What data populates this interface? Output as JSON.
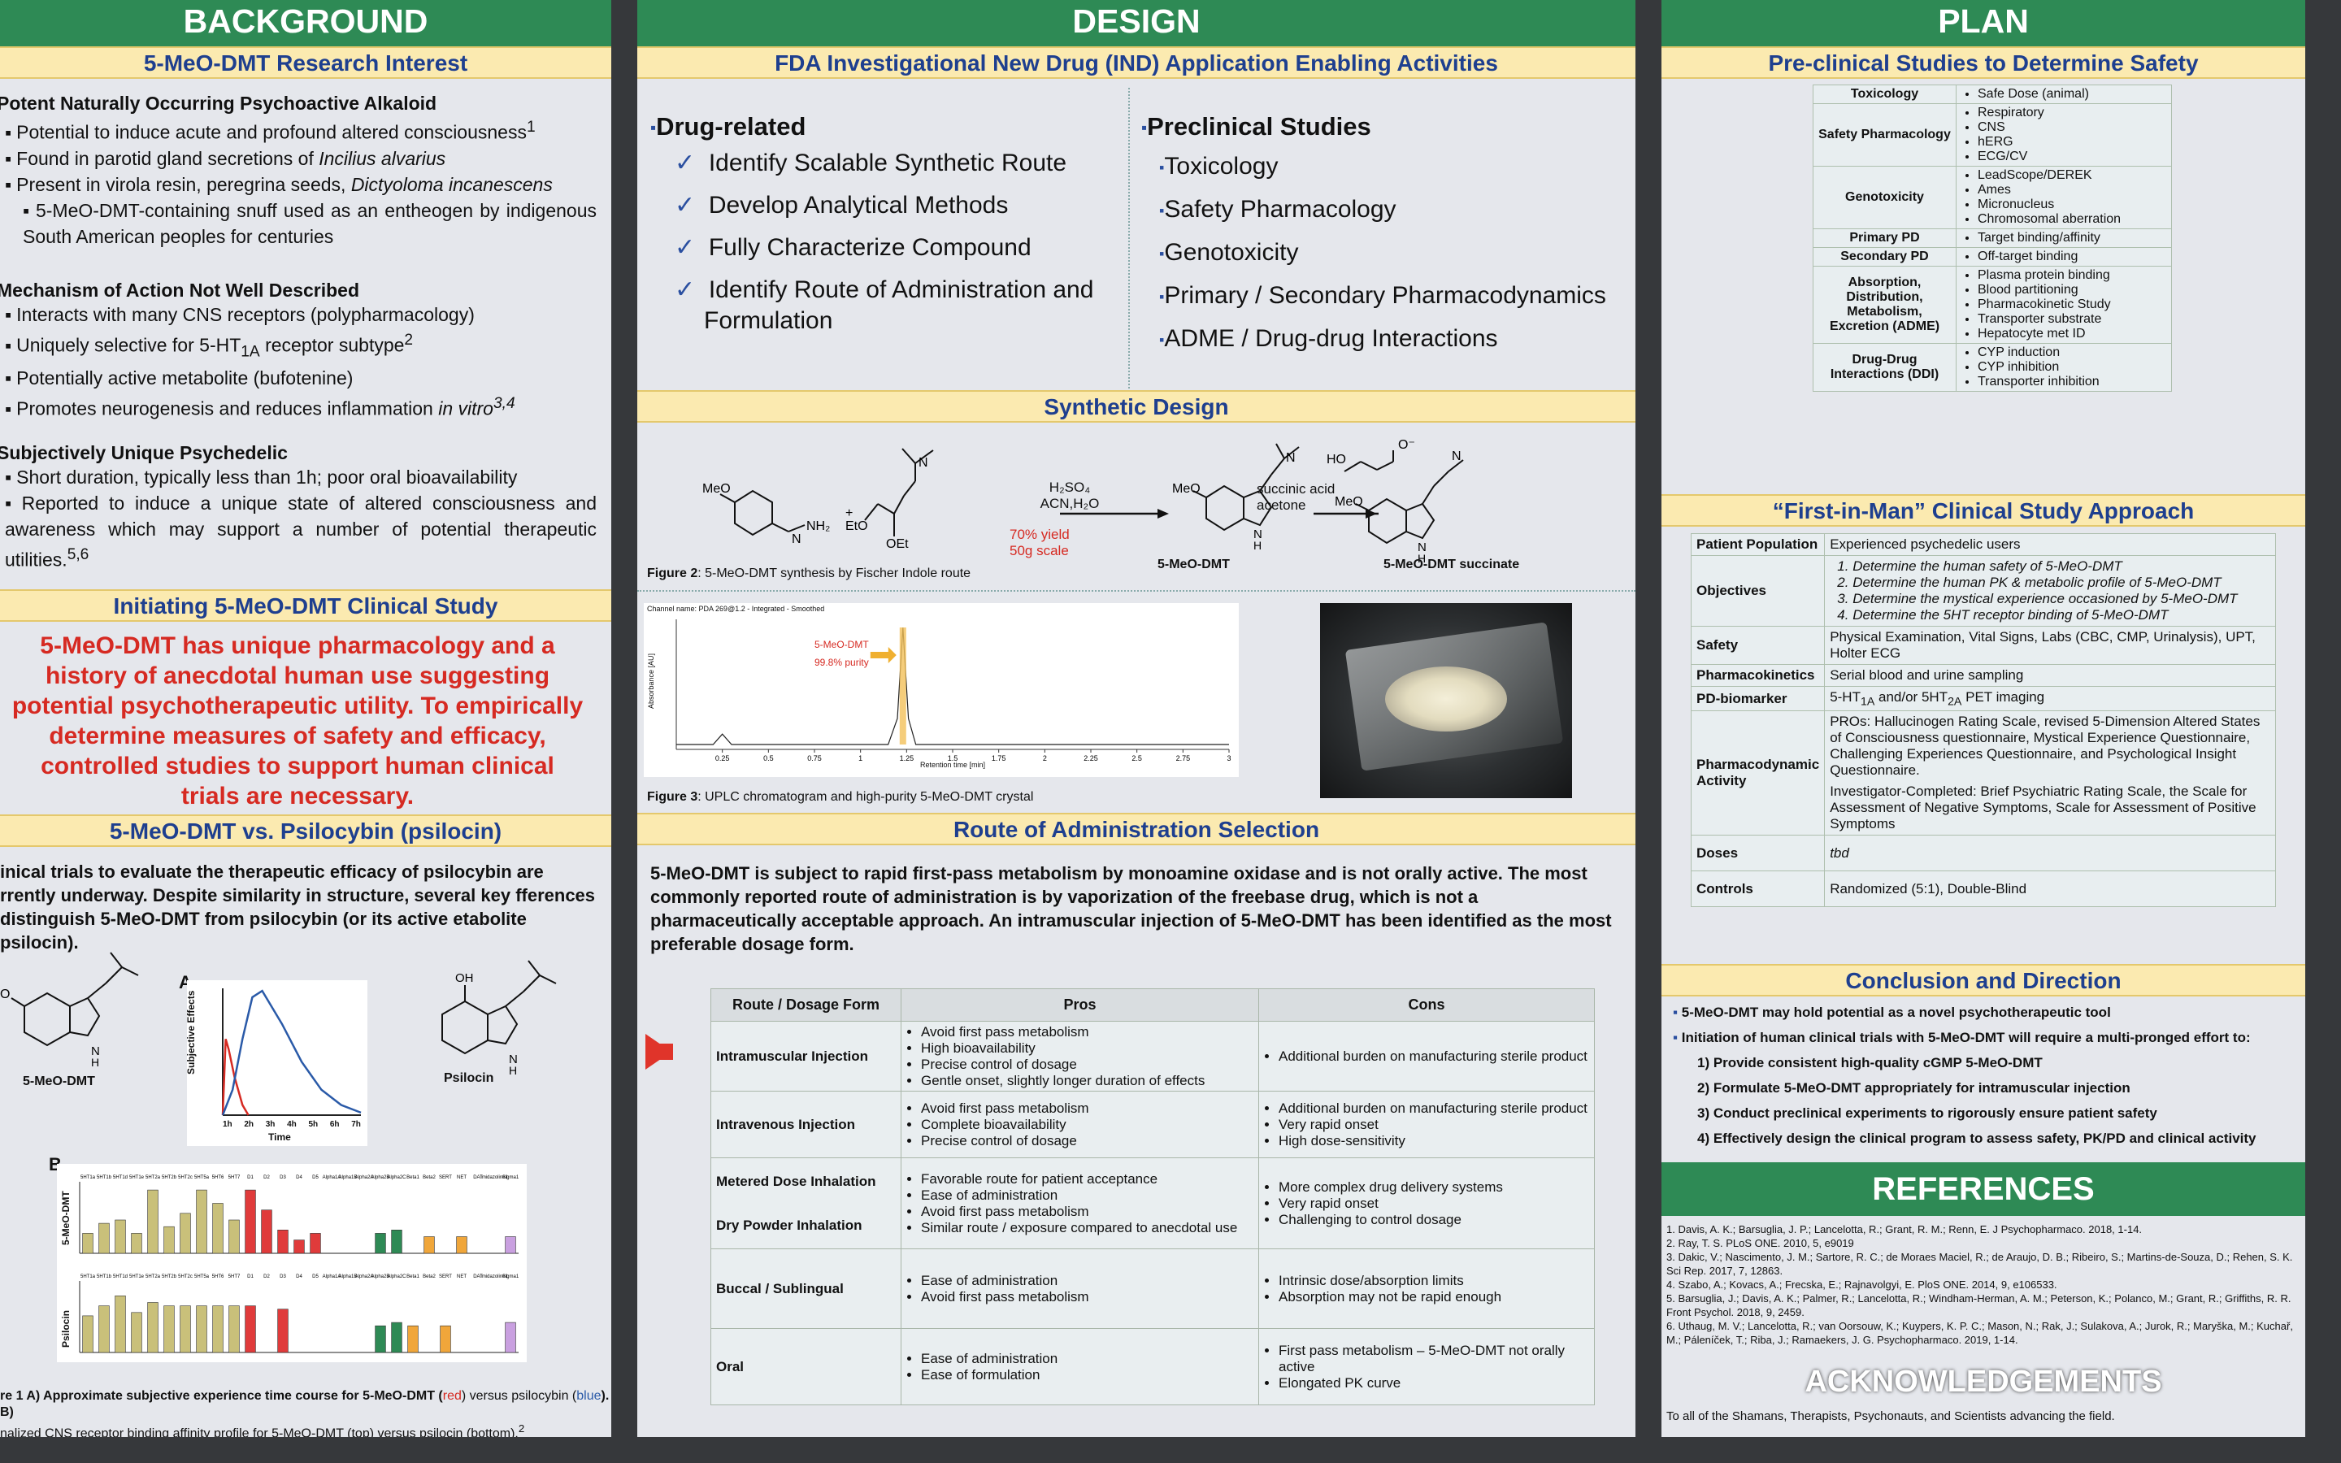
{
  "background": {
    "header": "BACKGROUND",
    "research_title": "5-MeO-DMT Research Interest",
    "g1": {
      "title": "Potent Naturally Occurring Psychoactive Alkaloid",
      "b1": "Potential to induce acute and profound altered consciousness",
      "b1sup": "1",
      "b2": "Found in parotid gland secretions of",
      "b2i": "Incilius alvarius",
      "b3": "Present in virola resin, peregrina seeds,",
      "b3i": "Dictyoloma incanescens",
      "b4": "5-MeO-DMT-containing snuff used as an entheogen by indigenous South American peoples for centuries"
    },
    "g2": {
      "title": "Mechanism of Action Not Well Described",
      "b1": "Interacts with many CNS receptors (polypharmacology)",
      "b2": "Uniquely selective for 5-HT",
      "b2sub": "1A",
      "b2b": " receptor subtype",
      "b2sup": "2",
      "b3": "Potentially active metabolite (bufotenine)",
      "b4": "Promotes neurogenesis and reduces inflammation",
      "b4i": "in vitro",
      "b4sup": "3,4"
    },
    "g3": {
      "title": "Subjectively Unique Psychedelic",
      "b1": "Short duration, typically less than 1h; poor oral bioavailability",
      "b2": "Reported to induce a unique state of altered consciousness and awareness which may support a number of potential therapeutic utilities.",
      "b2sup": "5,6"
    },
    "initiating_title": "Initiating 5-MeO-DMT Clinical Study",
    "initiating_text": "5-MeO-DMT has unique pharmacology and a history of anecdotal human use suggesting potential psychotherapeutic utility. To empirically determine measures of safety and efficacy, controlled studies to support human clinical trials are necessary.",
    "vs_title": "5-MeO-DMT vs. Psilocybin (psilocin)",
    "vs_text": "inical trials to evaluate the therapeutic efficacy of psilocybin are rrently underway.  Despite similarity in structure, several key fferences distinguish 5-MeO-DMT from psilocybin (or its active etabolite psilocin).",
    "mol1": "5-MeO-DMT",
    "mol2": "Psilocin",
    "panel_a": "A",
    "panel_b": "B",
    "a_ylabel": "Subjective Effects",
    "a_xlabel": "Time",
    "a_ticks": [
      "1h",
      "2h",
      "3h",
      "4h",
      "5h",
      "6h",
      "7h"
    ],
    "b_ylabel1": "5-MeO-DMT",
    "b_ylabel2": "Psilocin",
    "fig1_caption_pre": "re 1  A) Approximate subjective experience time course for 5-MeO-DMT (",
    "fig1_red": "red",
    "fig1_mid": ") versus psilocybin (",
    "fig1_blue": "blue",
    "fig1_post": "). B)",
    "fig1_caption2": "nalized CNS receptor binding affinity profile for 5-MeO-DMT (top) versus psilocin (bottom).",
    "fig1_sup": "2"
  },
  "design": {
    "header": "DESIGN",
    "fda_title": "FDA Investigational New Drug (IND) Application Enabling Activities",
    "drug_title": "Drug-related",
    "drug_items": [
      "Identify Scalable Synthetic Route",
      "Develop Analytical Methods",
      "Fully Characterize Compound",
      "Identify Route of Administration and Formulation"
    ],
    "pre_title": "Preclinical Studies",
    "pre_items": [
      "Toxicology",
      "Safety Pharmacology",
      "Genotoxicity",
      "Primary / Secondary Pharmacodynamics",
      "ADME / Drug-drug Interactions"
    ],
    "synthetic_title": "Synthetic Design",
    "rxn_cond1": "H₂SO₄",
    "rxn_cond2": "ACN,H₂O",
    "rxn_yield": "70% yield",
    "rxn_scale": "50g scale",
    "rxn_reagent1": "succinic acid",
    "rxn_reagent2": "acetone",
    "prod1": "5-MeO-DMT",
    "prod2": "5-MeO-DMT succinate",
    "fig2_label": "Figure 2",
    "fig2_text": ": 5-MeO-DMT synthesis by Fischer Indole route",
    "chrom_title": "Channel name: PDA 269@1.2 - Integrated - Smoothed",
    "chrom_peak": "5-MeO-DMT",
    "chrom_purity": "99.8% purity",
    "chrom_xlabel": "Retention time [min]",
    "chrom_ylabel": "Absorbance [AU]",
    "fig3_label": "Figure 3",
    "fig3_text": ": UPLC chromatogram and high-purity 5-MeO-DMT crystal",
    "roa_title": "Route of Administration Selection",
    "roa_text": "5-MeO-DMT is subject to rapid first-pass metabolism by monoamine oxidase and is not orally active. The most commonly reported route of administration is by vaporization of the freebase drug, which is not a pharmaceutically acceptable approach.  An intramuscular injection of 5-MeO-DMT has been identified as the most preferable dosage form.",
    "roa_headers": [
      "Route / Dosage Form",
      "Pros",
      "Cons"
    ],
    "roa_rows": [
      {
        "route": "Intramuscular Injection",
        "pros": [
          "Avoid first pass metabolism",
          "High bioavailability",
          "Precise control of dosage",
          "Gentle onset, slightly longer duration of effects"
        ],
        "cons": [
          "Additional burden on manufacturing sterile product"
        ]
      },
      {
        "route": "Intravenous Injection",
        "pros": [
          "Avoid first pass metabolism",
          "Complete bioavailability",
          "Precise control of dosage"
        ],
        "cons": [
          "Additional burden on manufacturing sterile product",
          "Very rapid onset",
          "High dose-sensitivity"
        ]
      },
      {
        "route": "Metered Dose Inhalation",
        "route2": "Dry Powder Inhalation",
        "pros": [
          "Favorable route for patient acceptance",
          "Ease of administration",
          "Avoid first pass metabolism",
          "Similar route / exposure compared to anecdotal use"
        ],
        "cons": [
          "More complex drug delivery systems",
          "Very rapid onset",
          "Challenging to control dosage"
        ]
      },
      {
        "route": "Buccal / Sublingual",
        "pros": [
          "Ease of administration",
          "Avoid first pass metabolism"
        ],
        "cons": [
          "Intrinsic dose/absorption limits",
          "Absorption may not be rapid enough"
        ]
      },
      {
        "route": "Oral",
        "pros": [
          "Ease of administration",
          "Ease of formulation"
        ],
        "cons": [
          "First pass metabolism – 5-MeO-DMT not orally active",
          "Elongated PK curve"
        ]
      }
    ]
  },
  "plan": {
    "header": "PLAN",
    "preclinical_title": "Pre-clinical Studies to Determine Safety",
    "safety_rows": [
      {
        "k": "Toxicology",
        "v": [
          "Safe Dose (animal)"
        ]
      },
      {
        "k": "Safety Pharmacology",
        "v": [
          "Respiratory",
          "CNS",
          "hERG",
          "ECG/CV"
        ]
      },
      {
        "k": "Genotoxicity",
        "v": [
          "LeadScope/DEREK",
          "Ames",
          "Micronucleus",
          "Chromosomal aberration"
        ]
      },
      {
        "k": "Primary PD",
        "v": [
          "Target binding/affinity"
        ]
      },
      {
        "k": "Secondary PD",
        "v": [
          "Off-target binding"
        ]
      },
      {
        "k": "Absorption, Distribution, Metabolism, Excretion (ADME)",
        "v": [
          "Plasma protein binding",
          "Blood partitioning",
          "Pharmacokinetic Study",
          "Transporter substrate",
          "Hepatocyte met ID"
        ]
      },
      {
        "k": "Drug-Drug Interactions (DDI)",
        "v": [
          "CYP induction",
          "CYP inhibition",
          "Transporter inhibition"
        ]
      }
    ],
    "fim_title": "“First-in-Man” Clinical Study Approach",
    "fim": {
      "pop_k": "Patient Population",
      "pop_v": "Experienced psychedelic users",
      "obj_k": "Objectives",
      "obj_v": [
        "Determine the human safety of 5-MeO-DMT",
        "Determine the human PK & metabolic profile of 5-MeO-DMT",
        "Determine the mystical experience occasioned by 5-MeO-DMT",
        "Determine the 5HT receptor binding of 5-MeO-DMT"
      ],
      "safety_k": "Safety",
      "safety_v": "Physical Examination, Vital Signs, Labs (CBC, CMP, Urinalysis), UPT, Holter ECG",
      "pk_k": "Pharmacokinetics",
      "pk_v": "Serial blood and urine sampling",
      "pd_k": "PD-biomarker",
      "pd_v1": "5-HT",
      "pd_sub1": "1A",
      "pd_v2": " and/or 5HT",
      "pd_sub2": "2A",
      "pd_v3": " PET imaging",
      "pda_k": "Pharmacodynamic Activity",
      "pda_v1": "PROs: Hallucinogen Rating Scale, revised 5-Dimension Altered States of Consciousness questionnaire, Mystical Experience Questionnaire, Challenging Experiences Questionnaire, and Psychological Insight Questionnaire.",
      "pda_v2": "Investigator-Completed: Brief Psychiatric Rating Scale, the Scale for Assessment of Negative Symptoms, Scale for Assessment of Positive Symptoms",
      "doses_k": "Doses",
      "doses_v": "tbd",
      "ctrl_k": "Controls",
      "ctrl_v": "Randomized (5:1), Double-Blind"
    },
    "conc_title": "Conclusion and Direction",
    "conc_b1": "5-MeO-DMT may hold potential as a novel psychotherapeutic tool",
    "conc_b2": "Initiation of human clinical trials with 5-MeO-DMT will require a multi-pronged effort to:",
    "conc_steps": [
      "1) Provide consistent high-quality cGMP 5-MeO-DMT",
      "2) Formulate 5-MeO-DMT appropriately for intramuscular injection",
      "3) Conduct preclinical experiments to rigorously ensure patient safety",
      "4) Effectively design the clinical program to assess safety, PK/PD and clinical activity"
    ],
    "refs_title": "REFERENCES",
    "refs": [
      "1.    Davis, A. K.; Barsuglia, J. P.; Lancelotta, R.; Grant, R. M.; Renn, E. J Psychopharmaco. 2018, 1-14.",
      "2.    Ray, T. S. PLoS ONE. 2010, 5, e9019",
      "3.    Dakic, V.; Nascimento, J. M.; Sartore, R. C.; de Moraes Maciel, R.; de Araujo, D. B.; Ribeiro, S.; Martins-de-Souza, D.; Rehen, S. K. Sci Rep. 2017, 7, 12863.",
      "4.    Szabo, A.; Kovacs, A.; Frecska, E.; Rajnavolgyi, E. PloS ONE. 2014, 9, e106533.",
      "5.    Barsuglia, J.; Davis, A. K.; Palmer, R.; Lancelotta, R.; Windham-Herman, A. M.; Peterson, K.; Polanco, M.; Grant, R.; Griffiths, R. R. Front Psychol. 2018, 9, 2459.",
      "6.    Uthaug, M. V.; Lancelotta, R.; van Oorsouw, K.; Kuypers, K. P. C.; Mason, N.; Rak, J.; Sulakova, A.; Jurok, R.; Maryška, M.; Kuchař, M.; Páleníček, T.; Riba, J.; Ramaekers, J. G. Psychopharmaco. 2019, 1-14."
    ],
    "ack_title": "ACKNOWLEDGEMENTS",
    "ack_text": "To all of the Shamans, Therapists, Psychonauts, and Scientists advancing the field."
  },
  "chart_data": [
    {
      "type": "line",
      "title": "",
      "xlabel": "Time",
      "ylabel": "Subjective Effects",
      "x_ticks": [
        "1h",
        "2h",
        "3h",
        "4h",
        "5h",
        "6h",
        "7h"
      ],
      "series": [
        {
          "name": "5-MeO-DMT",
          "color": "#d62a22",
          "x": [
            0,
            0.15,
            0.3,
            0.6,
            1.0,
            1.3
          ],
          "y": [
            0,
            0.6,
            0.52,
            0.3,
            0.08,
            0
          ]
        },
        {
          "name": "Psilocybin",
          "color": "#2a5aa8",
          "x": [
            0,
            0.5,
            1.0,
            1.5,
            2.0,
            3.0,
            4.0,
            5.0,
            6.0,
            7.0
          ],
          "y": [
            0,
            0.2,
            0.6,
            0.93,
            0.98,
            0.72,
            0.42,
            0.2,
            0.08,
            0.02
          ]
        }
      ]
    },
    {
      "type": "bar",
      "title": "",
      "ylabel": "5-MeO-DMT",
      "categories": [
        "5HT1a",
        "5HT1b",
        "5HT1d",
        "5HT1e",
        "5HT2a",
        "5HT2b",
        "5HT2c",
        "5HT5a",
        "5HT6",
        "5HT7",
        "D1",
        "D2",
        "D3",
        "D4",
        "D5",
        "Alpha1A",
        "Alpha1B",
        "Alpha2A",
        "Alpha2B",
        "Alpha2C",
        "Beta1",
        "Beta2",
        "SERT",
        "NET",
        "DAT",
        "Imidazoline1",
        "Sigma1"
      ],
      "values": [
        0.3,
        0.45,
        0.5,
        0.3,
        0.95,
        0.4,
        0.6,
        0.95,
        0.75,
        0.5,
        0.95,
        0.65,
        0.35,
        0.2,
        0.3,
        0,
        0,
        0,
        0.3,
        0.35,
        0,
        0.25,
        0,
        0.25,
        0,
        0,
        0.25
      ],
      "colors": [
        "#c9c07a",
        "#c9c07a",
        "#c9c07a",
        "#c9c07a",
        "#c9c07a",
        "#c9c07a",
        "#c9c07a",
        "#c9c07a",
        "#c9c07a",
        "#c9c07a",
        "#e03b3b",
        "#e03b3b",
        "#e03b3b",
        "#e03b3b",
        "#e03b3b",
        "#2e8a55",
        "#2e8a55",
        "#2e8a55",
        "#2e8a55",
        "#2e8a55",
        "#f0a63a",
        "#f0a63a",
        "#f0a63a",
        "#f0a63a",
        "#c9a0e0",
        "#c9a0e0",
        "#c9a0e0"
      ]
    },
    {
      "type": "bar",
      "title": "",
      "ylabel": "Psilocin",
      "categories": [
        "5HT1a",
        "5HT1b",
        "5HT1d",
        "5HT1e",
        "5HT2a",
        "5HT2b",
        "5HT2c",
        "5HT5a",
        "5HT6",
        "5HT7",
        "D1",
        "D2",
        "D3",
        "D4",
        "D5",
        "Alpha1A",
        "Alpha1B",
        "Alpha2A",
        "Alpha2B",
        "Alpha2C",
        "Beta1",
        "Beta2",
        "SERT",
        "NET",
        "DAT",
        "Imidazoline1",
        "Sigma1"
      ],
      "values": [
        0.55,
        0.7,
        0.85,
        0.6,
        0.75,
        0.7,
        0.7,
        0.7,
        0.7,
        0.7,
        0.7,
        0,
        0.65,
        0,
        0,
        0,
        0,
        0,
        0.4,
        0.45,
        0.4,
        0,
        0.4,
        0,
        0,
        0,
        0.45
      ],
      "colors": [
        "#c9c07a",
        "#c9c07a",
        "#c9c07a",
        "#c9c07a",
        "#c9c07a",
        "#c9c07a",
        "#c9c07a",
        "#c9c07a",
        "#c9c07a",
        "#c9c07a",
        "#e03b3b",
        "#e03b3b",
        "#e03b3b",
        "#e03b3b",
        "#e03b3b",
        "#2e8a55",
        "#2e8a55",
        "#2e8a55",
        "#2e8a55",
        "#2e8a55",
        "#f0a63a",
        "#f0a63a",
        "#f0a63a",
        "#f0a63a",
        "#c9a0e0",
        "#c9a0e0",
        "#c9a0e0"
      ]
    },
    {
      "type": "line",
      "title": "Channel name: PDA 269@1.2 - Integrated - Smoothed",
      "xlabel": "Retention time [min]",
      "ylabel": "Absorbance [AU]",
      "x_ticks": [
        0.25,
        0.5,
        0.75,
        1,
        1.25,
        1.5,
        1.75,
        2,
        2.25,
        2.5,
        2.75,
        3
      ],
      "series": [
        {
          "name": "5-MeO-DMT",
          "x": [
            0,
            0.2,
            0.25,
            0.3,
            1.15,
            1.2,
            1.23,
            1.26,
            1.3,
            3.0
          ],
          "y": [
            0.0,
            0.0,
            0.004,
            0.0,
            0.0,
            0.01,
            0.045,
            0.01,
            0.0,
            0.0
          ]
        }
      ]
    }
  ]
}
